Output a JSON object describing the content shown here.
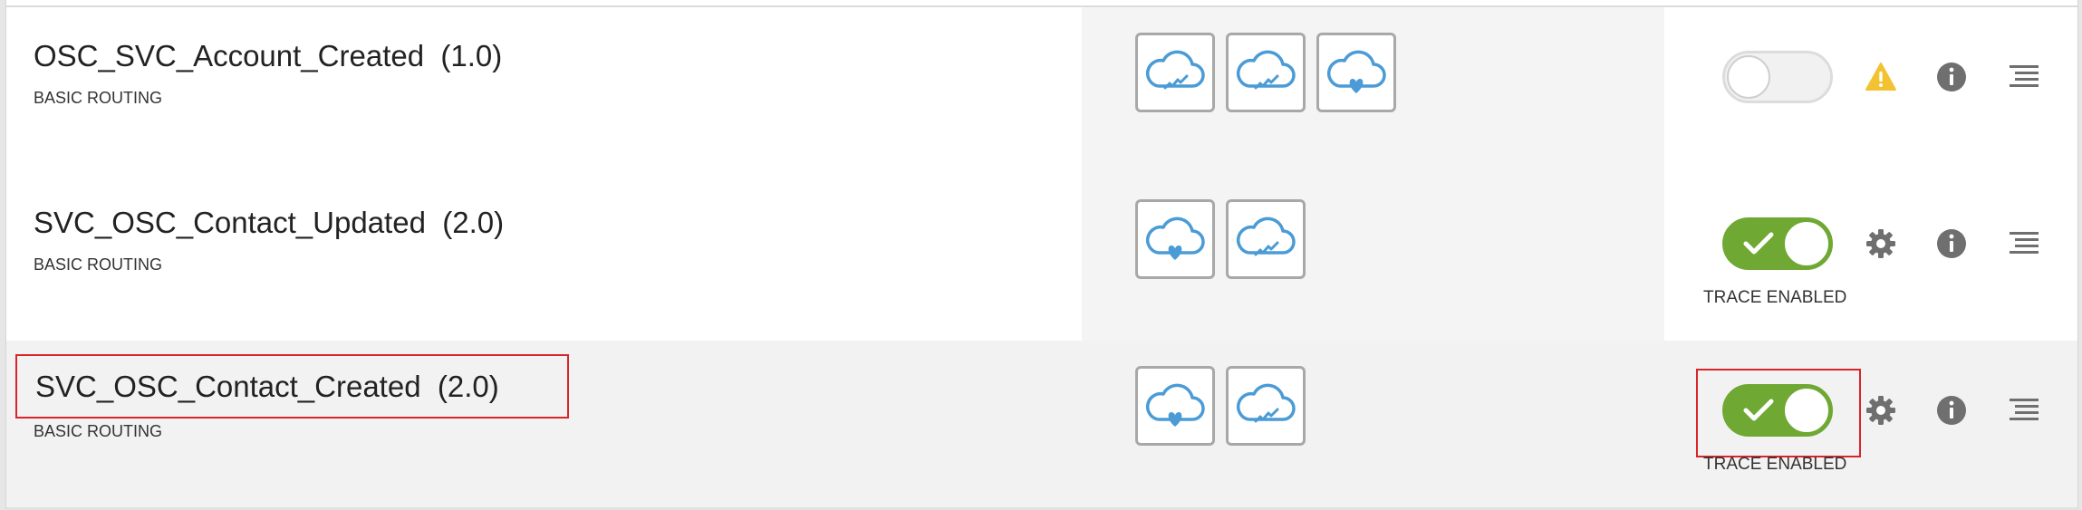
{
  "integrations": [
    {
      "name": "OSC_SVC_Account_Created",
      "version": "(1.0)",
      "pattern": "BASIC ROUTING",
      "adapters": [
        "cloud-signal-icon",
        "cloud-signal-icon",
        "cloud-heart-icon"
      ],
      "active": false,
      "status_icon": "warning-icon",
      "trace_label": "",
      "selected": false
    },
    {
      "name": "SVC_OSC_Contact_Updated",
      "version": "(2.0)",
      "pattern": "BASIC ROUTING",
      "adapters": [
        "cloud-heart-icon",
        "cloud-signal-icon"
      ],
      "active": true,
      "status_icon": "gear-icon",
      "trace_label": "TRACE ENABLED",
      "selected": false
    },
    {
      "name": "SVC_OSC_Contact_Created",
      "version": "(2.0)",
      "pattern": "BASIC ROUTING",
      "adapters": [
        "cloud-heart-icon",
        "cloud-signal-icon"
      ],
      "active": true,
      "status_icon": "gear-icon",
      "trace_label": "TRACE ENABLED",
      "selected": true
    }
  ],
  "colors": {
    "toggle_on": "#6fa832",
    "adapter_blue": "#4a9bd6",
    "warning": "#f2c230",
    "highlight_border": "#d9252a",
    "icon_gray": "#6f6f6f"
  }
}
